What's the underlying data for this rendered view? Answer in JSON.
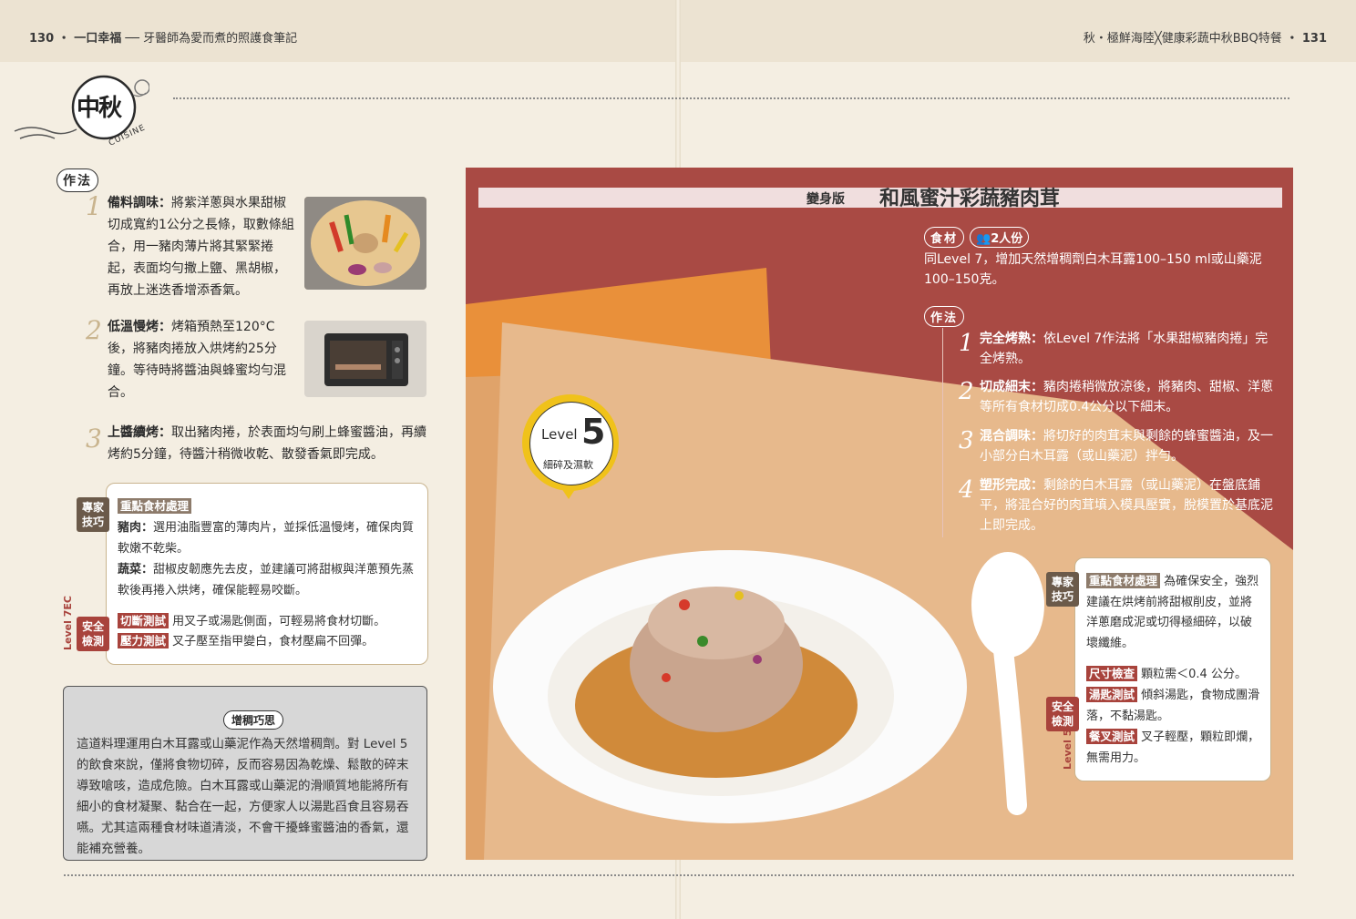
{
  "header": {
    "left_page": "130",
    "left_title": "一口幸福",
    "left_sub": "牙醫師為愛而煮的照護食筆記",
    "right_title": "秋・極鮮海陸╳健康彩蔬中秋BBQ特餐",
    "right_page": "131"
  },
  "logo": {
    "main": "中秋",
    "sub": "CUISINE"
  },
  "left": {
    "method_label": "作法",
    "steps": [
      {
        "num": "1",
        "title": "備料調味：",
        "text": "將紫洋蔥與水果甜椒切成寬約1公分之長條，取數條組合，用一豬肉薄片將其緊緊捲起，表面均勻撒上鹽、黑胡椒，再放上迷迭香增添香氣。"
      },
      {
        "num": "2",
        "title": "低溫慢烤：",
        "text": "烤箱預熱至120°C後，將豬肉捲放入烘烤約25分鐘。等待時將醬油與蜂蜜均勻混合。"
      },
      {
        "num": "3",
        "title": "上醬續烤：",
        "text": "取出豬肉捲，於表面均勻刷上蜂蜜醬油，再續烤約5分鐘，待醬汁稍微收乾、散發香氣即完成。"
      }
    ],
    "tip": {
      "expert_tag": "專家技巧",
      "safety_tag": "安全檢測",
      "vertical_label": "Level 7EC",
      "heading": "重點食材處理",
      "pork_label": "豬肉：",
      "pork_text": "選用油脂豐富的薄肉片，並採低溫慢烤，確保肉質軟嫩不乾柴。",
      "veg_label": "蔬菜：",
      "veg_text": "甜椒皮韌應先去皮，並建議可將甜椒與洋蔥預先蒸軟後再捲入烘烤，確保能輕易咬斷。",
      "test1_label": "切斷測試",
      "test1_text": "用叉子或湯匙側面，可輕易將食材切斷。",
      "test2_label": "壓力測試",
      "test2_text": "叉子壓至指甲變白，食材壓扁不回彈。"
    },
    "thicken": {
      "title": "增稠巧思",
      "text": "這道料理運用白木耳露或山藥泥作為天然增稠劑。對 Level 5 的飲食來說，僅將食物切碎，反而容易因為乾燥、鬆散的碎末導致嗆咳，造成危險。白木耳露或山藥泥的滑順質地能將所有細小的食材凝聚、黏合在一起，方便家人以湯匙舀食且容易吞嚥。尤其這兩種食材味道清淡，不會干擾蜂蜜醬油的香氣，還能補充營養。"
    }
  },
  "right": {
    "variant_label": "變身版",
    "dish_title": "和風蜜汁彩蔬豬肉茸",
    "ingredients_label": "食材",
    "servings": "2人份",
    "ingredients_text": "同Level 7，增加天然增稠劑白木耳露100–150 ml或山藥泥100–150克。",
    "method_label": "作法",
    "steps": [
      {
        "num": "1",
        "title": "完全烤熟：",
        "text": "依Level 7作法將「水果甜椒豬肉捲」完全烤熟。"
      },
      {
        "num": "2",
        "title": "切成細末：",
        "text": "豬肉捲稍微放涼後，將豬肉、甜椒、洋蔥等所有食材切成0.4公分以下細末。"
      },
      {
        "num": "3",
        "title": "混合調味：",
        "text": "將切好的肉茸末與剩餘的蜂蜜醬油，及一小部分白木耳露（或山藥泥）拌勻。"
      },
      {
        "num": "4",
        "title": "塑形完成：",
        "text": "剩餘的白木耳露（或山藥泥）在盤底鋪平，將混合好的肉茸填入模具壓實，脫模置於基底泥上即完成。"
      }
    ],
    "level": {
      "word": "Level",
      "num": "5",
      "desc": "細碎及濕軟"
    },
    "tip": {
      "expert_tag": "專家技巧",
      "safety_tag": "安全檢測",
      "vertical_label": "Level 5",
      "heading": "重點食材處理",
      "heading_text": "為確保安全，強烈建議在烘烤前將甜椒削皮，並將洋蔥磨成泥或切得極細碎，以破壞纖維。",
      "test1_label": "尺寸檢查",
      "test1_text": "顆粒需＜0.4 公分。",
      "test2_label": "湯匙測試",
      "test2_text": "傾斜湯匙，食物成團滑落，不黏湯匙。",
      "test3_label": "餐叉測試",
      "test3_text": "叉子輕壓，顆粒即爛，無需用力。"
    }
  }
}
